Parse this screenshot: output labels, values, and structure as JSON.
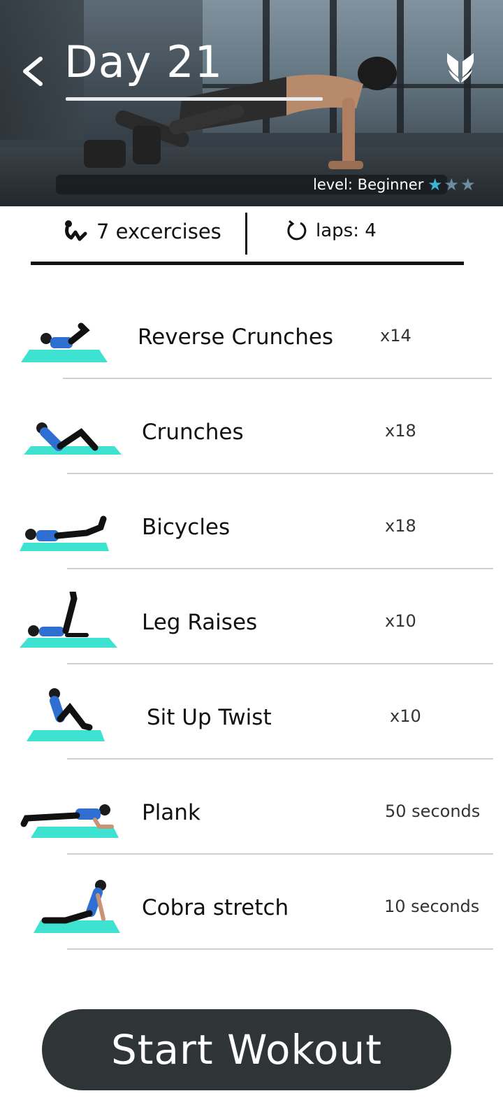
{
  "header": {
    "title": "Day 21",
    "level": "level: Beginner",
    "difficulty_stars": {
      "filled": 1,
      "total": 3
    },
    "colors": {
      "star_filled": "#39b5d6",
      "star_empty": "#6f8da0"
    }
  },
  "stats": {
    "exercises": "7 excercises",
    "laps": "laps: 4"
  },
  "exercises": [
    {
      "name": "Reverse Crunches",
      "count": "x14"
    },
    {
      "name": "Crunches",
      "count": "x18"
    },
    {
      "name": "Bicycles",
      "count": "x18"
    },
    {
      "name": "Leg Raises",
      "count": "x10"
    },
    {
      "name": "Sit Up Twist",
      "count": "x10"
    },
    {
      "name": "Plank",
      "count": "50 seconds"
    },
    {
      "name": "Cobra stretch",
      "count": "10 seconds"
    }
  ],
  "start_button": {
    "label": "Start Wokout",
    "color": "#2f3537"
  },
  "accent": {
    "mat": "#3de3d0",
    "shirt": "#2f6fd1"
  }
}
